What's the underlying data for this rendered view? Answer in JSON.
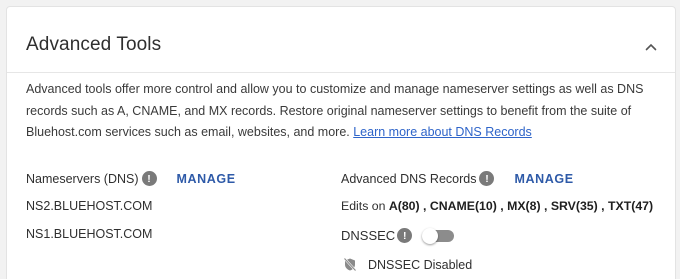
{
  "section": {
    "title": "Advanced Tools",
    "description_text": "Advanced tools offer more control and allow you to customize and manage nameserver settings as well as DNS records such as A, CNAME, and MX records. Restore original nameserver settings to benefit from the suite of Bluehost.com services such as email, websites, and more.",
    "learn_more_link": "Learn more about DNS Records"
  },
  "nameservers": {
    "label": "Nameservers (DNS)",
    "info_glyph": "!",
    "manage_label": "MANAGE",
    "servers": [
      "NS2.BLUEHOST.COM",
      "NS1.BLUEHOST.COM"
    ]
  },
  "dns_records": {
    "label": "Advanced DNS Records",
    "info_glyph": "!",
    "manage_label": "MANAGE",
    "edits_prefix": "Edits on",
    "edits": [
      {
        "text": "A(80)",
        "sep": " , "
      },
      {
        "text": "CNAME(10)",
        "sep": " , "
      },
      {
        "text": "MX(8)",
        "sep": " , "
      },
      {
        "text": "SRV(35)",
        "sep": " , "
      },
      {
        "text": "TXT(47)",
        "sep": ""
      }
    ]
  },
  "dnssec": {
    "label": "DNSSEC",
    "info_glyph": "!",
    "enabled": false,
    "status_text": "DNSSEC Disabled"
  },
  "colors": {
    "link": "#2e64c9",
    "manage": "#2e5aa8",
    "info_icon_bg": "#7a7a7a",
    "toggle_off": "#8c8c8c"
  },
  "icons": {
    "collapse": "chevron-up-icon",
    "info": "info-icon",
    "status": "shield-off-icon"
  }
}
